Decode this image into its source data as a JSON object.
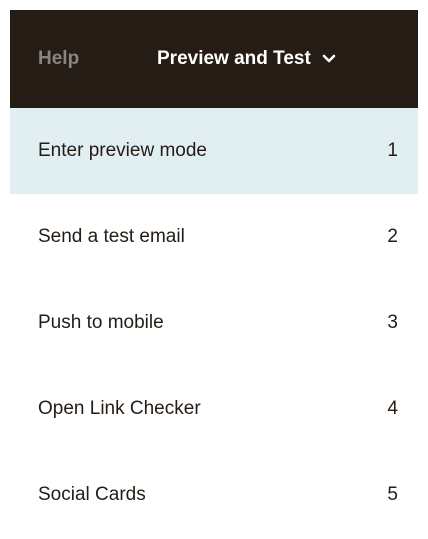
{
  "header": {
    "help_label": "Help",
    "menu_title": "Preview and Test",
    "menu_icon": "chevron-down-icon",
    "background_color": "#241c15"
  },
  "menu": {
    "active_background": "#e1eff2",
    "items": [
      {
        "label": "Enter preview mode",
        "shortcut": "1",
        "active": true
      },
      {
        "label": "Send a test email",
        "shortcut": "2",
        "active": false
      },
      {
        "label": "Push to mobile",
        "shortcut": "3",
        "active": false
      },
      {
        "label": "Open Link Checker",
        "shortcut": "4",
        "active": false
      },
      {
        "label": "Social Cards",
        "shortcut": "5",
        "active": false
      }
    ]
  }
}
